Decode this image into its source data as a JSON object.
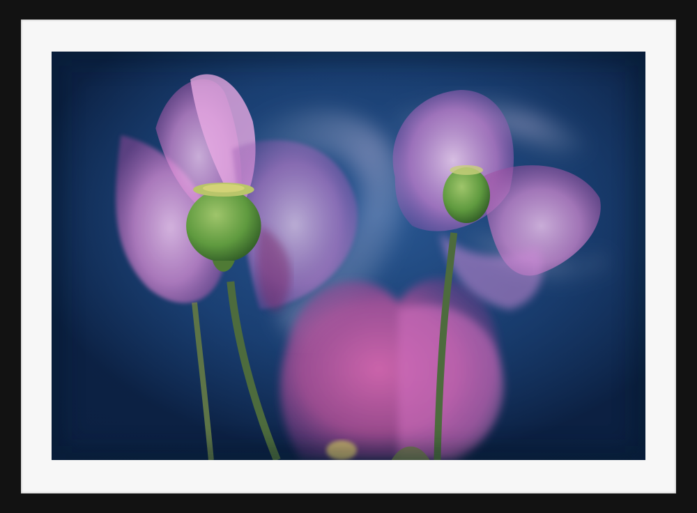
{
  "artwork": {
    "subject": "pink-poppies",
    "colors": {
      "frame": "#121212",
      "mat": "#f7f7f7",
      "background_dark": "#0d2448",
      "background_light": "#24508a",
      "petal_pink": "#d97fc8",
      "petal_light": "#efc4ef",
      "pod_green": "#5f9a3f",
      "stem_green": "#4d6b3d"
    }
  }
}
